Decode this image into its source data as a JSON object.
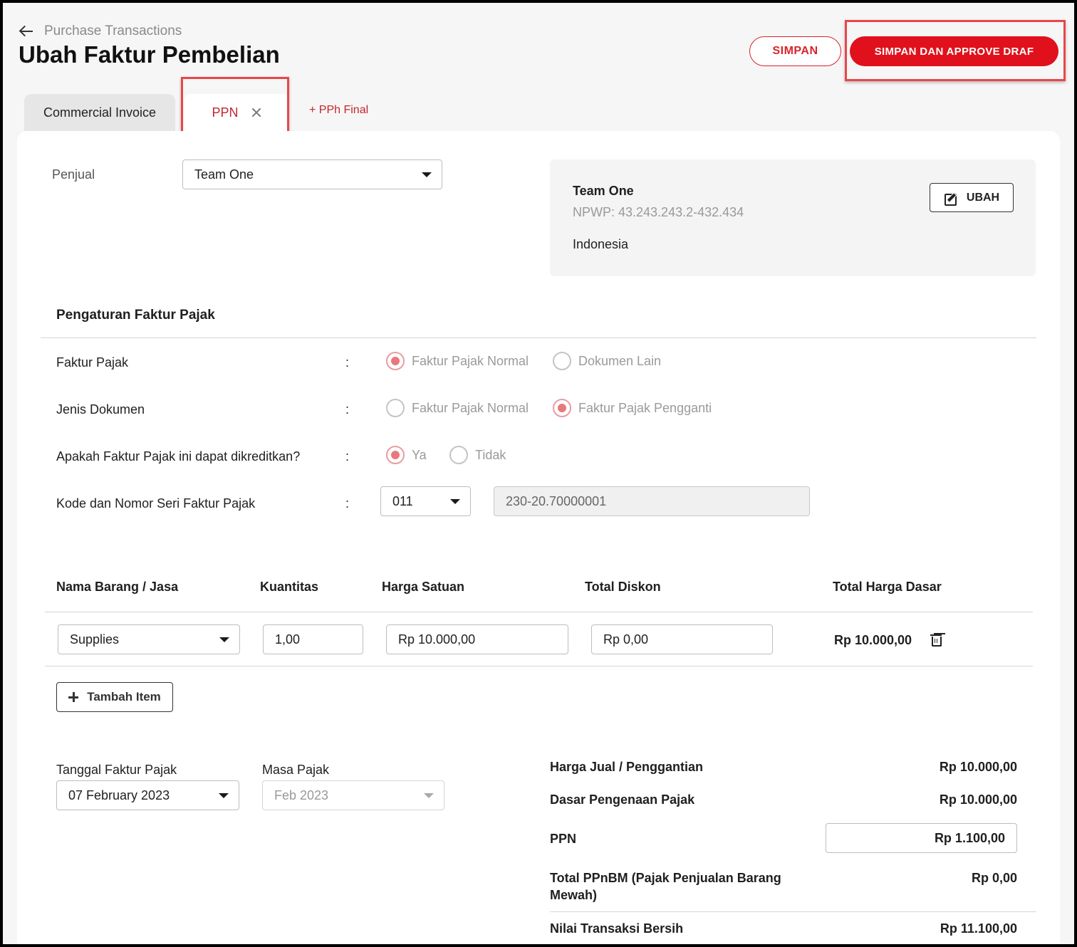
{
  "header": {
    "breadcrumb": "Purchase Transactions",
    "title": "Ubah Faktur Pembelian",
    "save_label": "SIMPAN",
    "save_approve_label": "SIMPAN DAN APPROVE DRAF"
  },
  "tabs": {
    "commercial_invoice": "Commercial Invoice",
    "ppn": "PPN",
    "add_pph": "+ PPh Final"
  },
  "seller": {
    "label": "Penjual",
    "selected": "Team One",
    "card": {
      "name": "Team One",
      "npwp": "NPWP: 43.243.243.2-432.434",
      "country": "Indonesia",
      "edit_label": "UBAH"
    }
  },
  "tax_settings": {
    "title": "Pengaturan Faktur Pajak",
    "colon": ":",
    "faktur_pajak": {
      "label": "Faktur Pajak",
      "options": [
        "Faktur Pajak Normal",
        "Dokumen Lain"
      ],
      "selected": 0
    },
    "jenis_dokumen": {
      "label": "Jenis Dokumen",
      "options": [
        "Faktur Pajak Normal",
        "Faktur Pajak Pengganti"
      ],
      "selected": 1
    },
    "dapat_dikreditkan": {
      "label": "Apakah Faktur Pajak ini dapat dikreditkan?",
      "options": [
        "Ya",
        "Tidak"
      ],
      "selected": 0
    },
    "kode_nomor": {
      "label": "Kode dan Nomor Seri Faktur Pajak",
      "code": "011",
      "serial": "230-20.70000001"
    }
  },
  "items_table": {
    "headers": [
      "Nama Barang / Jasa",
      "Kuantitas",
      "Harga Satuan",
      "Total Diskon",
      "Total Harga Dasar"
    ],
    "rows": [
      {
        "name": "Supplies",
        "quantity": "1,00",
        "unit_price": "Rp 10.000,00",
        "discount": "Rp 0,00",
        "total": "Rp 10.000,00"
      }
    ],
    "add_label": "Tambah Item"
  },
  "dates": {
    "tanggal_label": "Tanggal Faktur Pajak",
    "tanggal_value": "07 February 2023",
    "masa_label": "Masa Pajak",
    "masa_value": "Feb 2023"
  },
  "summary": {
    "harga_jual_label": "Harga Jual / Penggantian",
    "harga_jual_value": "Rp 10.000,00",
    "dpp_label": "Dasar Pengenaan Pajak",
    "dpp_value": "Rp 10.000,00",
    "ppn_label": "PPN",
    "ppn_value": "Rp 1.100,00",
    "ppnbm_label_1": "Total PPnBM (Pajak Penjualan Barang",
    "ppnbm_label_2": "Mewah)",
    "ppnbm_value": "Rp 0,00",
    "net_label": "Nilai Transaksi Bersih",
    "net_value": "Rp 11.100,00"
  },
  "colors": {
    "accent": "#e0111c",
    "highlight": "#e9464a"
  }
}
